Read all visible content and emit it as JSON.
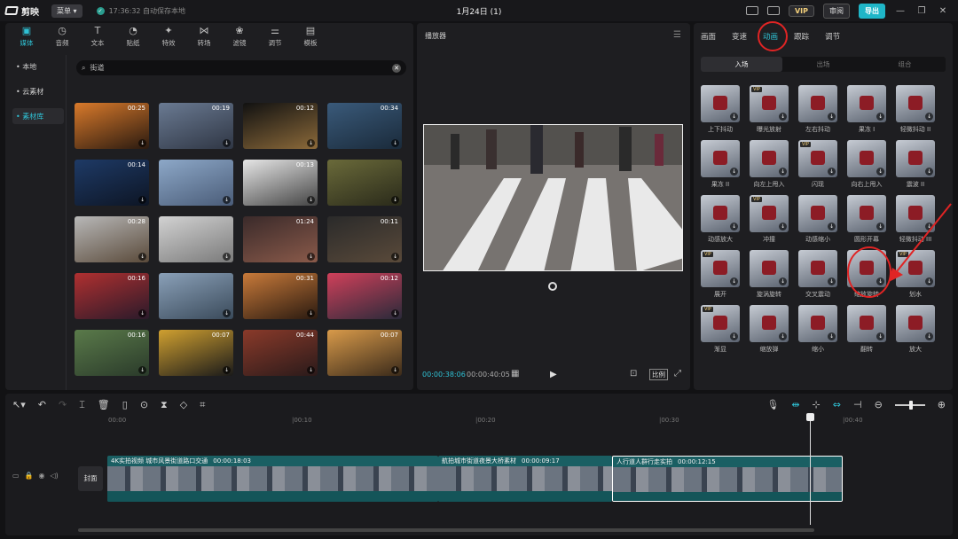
{
  "app": {
    "name": "剪映",
    "menu": "菜单",
    "save_status": "17:36:32 自动保存本地",
    "title": "1月24日 (1)",
    "vip": "VIP",
    "share": "审阅",
    "export": "导出"
  },
  "media": {
    "tabs": [
      {
        "label": "媒体",
        "icon": "media-icon",
        "active": true
      },
      {
        "label": "音频",
        "icon": "audio-icon"
      },
      {
        "label": "文本",
        "icon": "text-icon"
      },
      {
        "label": "贴纸",
        "icon": "sticker-icon"
      },
      {
        "label": "特效",
        "icon": "effects-icon"
      },
      {
        "label": "转场",
        "icon": "transition-icon"
      },
      {
        "label": "滤镜",
        "icon": "filter-icon"
      },
      {
        "label": "调节",
        "icon": "adjust-icon"
      },
      {
        "label": "模板",
        "icon": "template-icon"
      }
    ],
    "side": [
      "• 本地",
      "• 云素材",
      "• 素材库"
    ],
    "search_value": "街道",
    "thumbs": [
      {
        "dur": "00:25",
        "c1": "#d97a2b",
        "c2": "#2a1a10"
      },
      {
        "dur": "00:19",
        "c1": "#6a7a92",
        "c2": "#2f3644"
      },
      {
        "dur": "00:12",
        "c1": "#111111",
        "c2": "#8c6a3a"
      },
      {
        "dur": "00:34",
        "c1": "#3a5a7a",
        "c2": "#1a2a3a"
      },
      {
        "dur": "00:14",
        "c1": "#1e3a66",
        "c2": "#0d1524"
      },
      {
        "dur": "",
        "c1": "#8da8c8",
        "c2": "#4a5c78"
      },
      {
        "dur": "00:13",
        "c1": "#e6e6e6",
        "c2": "#444444"
      },
      {
        "dur": "",
        "c1": "#6a6a3a",
        "c2": "#2a2a1a"
      },
      {
        "dur": "00:28",
        "c1": "#b8b8b8",
        "c2": "#5a4a3a"
      },
      {
        "dur": "",
        "c1": "#d2d2d2",
        "c2": "#7a7a7a"
      },
      {
        "dur": "01:24",
        "c1": "#3a2a2a",
        "c2": "#8a5a4a"
      },
      {
        "dur": "00:11",
        "c1": "#2a2a2a",
        "c2": "#5a4a3a"
      },
      {
        "dur": "00:16",
        "c1": "#b03030",
        "c2": "#2a1a2a"
      },
      {
        "dur": "",
        "c1": "#8aa0b8",
        "c2": "#3a4a5a"
      },
      {
        "dur": "00:31",
        "c1": "#c87a3a",
        "c2": "#2a1a10"
      },
      {
        "dur": "00:12",
        "c1": "#d0405a",
        "c2": "#2a2a3a"
      },
      {
        "dur": "00:16",
        "c1": "#5a7a4a",
        "c2": "#2a3a2a"
      },
      {
        "dur": "00:07",
        "c1": "#d0a030",
        "c2": "#1a1a1a"
      },
      {
        "dur": "00:44",
        "c1": "#8a3a2a",
        "c2": "#2a1a1a"
      },
      {
        "dur": "00:07",
        "c1": "#d89a4a",
        "c2": "#3a2a1a"
      }
    ]
  },
  "player": {
    "title": "播放器",
    "time_current": "00:00:38:06",
    "time_total": "00:00:40:05",
    "ratio": "比例"
  },
  "props": {
    "tabs": [
      "画面",
      "变速",
      "动画",
      "跟踪",
      "调节"
    ],
    "active_tab": 2,
    "subtabs": [
      "入场",
      "出场",
      "组合"
    ],
    "anims": [
      {
        "label": "上下抖动",
        "vip": false
      },
      {
        "label": "曝光放射",
        "vip": true
      },
      {
        "label": "左右抖动",
        "vip": false
      },
      {
        "label": "果冻 I",
        "vip": false
      },
      {
        "label": "轻微抖动 II",
        "vip": false
      },
      {
        "label": "果冻 II",
        "vip": false
      },
      {
        "label": "向左上甩入",
        "vip": false
      },
      {
        "label": "闪现",
        "vip": true
      },
      {
        "label": "向右上甩入",
        "vip": false
      },
      {
        "label": "震波 II",
        "vip": false
      },
      {
        "label": "动感放大",
        "vip": false
      },
      {
        "label": "冲撞",
        "vip": true
      },
      {
        "label": "动感缩小",
        "vip": false
      },
      {
        "label": "圆形开幕",
        "vip": false
      },
      {
        "label": "轻微抖动 III",
        "vip": false
      },
      {
        "label": "展开",
        "vip": true
      },
      {
        "label": "旋涡旋转",
        "vip": false
      },
      {
        "label": "交叉震动",
        "vip": false
      },
      {
        "label": "缩放旋转",
        "vip": false
      },
      {
        "label": "划水",
        "vip": true
      },
      {
        "label": "渐显",
        "vip": true
      },
      {
        "label": "缩放弹",
        "vip": false
      },
      {
        "label": "缩小",
        "vip": false
      },
      {
        "label": "翻转",
        "vip": false
      },
      {
        "label": "放大",
        "vip": false
      }
    ]
  },
  "timeline": {
    "ruler": [
      "00:00",
      "|00:10",
      "|00:20",
      "|00:30",
      "|00:40"
    ],
    "cover": "封面",
    "clips": [
      {
        "title": "4K实拍视频 城市风景街道路口交通",
        "dur": "00:00:18:03"
      },
      {
        "title": "航拍城市街道夜景大桥素材",
        "dur": "00:00:09:17"
      },
      {
        "title": "人行道人群行走实拍",
        "dur": "00:00:12:15"
      }
    ]
  }
}
